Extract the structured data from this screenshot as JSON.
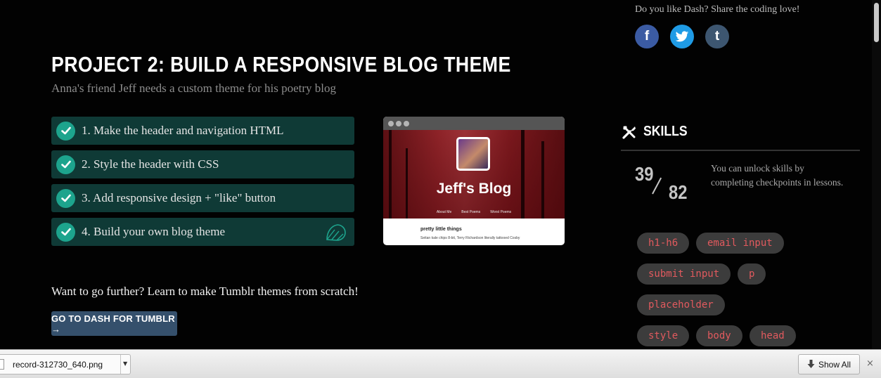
{
  "project": {
    "title": "PROJECT 2: BUILD A RESPONSIVE BLOG THEME",
    "subtitle": "Anna's friend Jeff needs a custom theme for his poetry blog"
  },
  "checklist": [
    {
      "label": "1. Make the header and navigation HTML",
      "done": true
    },
    {
      "label": "2. Style the header with CSS",
      "done": true
    },
    {
      "label": "3. Add responsive design + \"like\" button",
      "done": true
    },
    {
      "label": "4. Build your own blog theme",
      "done": true
    }
  ],
  "preview": {
    "blog_title": "Jeff's Blog",
    "nav": [
      "About Me",
      "Best Poems",
      "Worst Poems"
    ],
    "post_title": "pretty little things",
    "post_text": "Seitan kale chips 8-bit, Terry Richardson literally tattooed Cosby"
  },
  "further": {
    "text": "Want to go further? Learn to make Tumblr themes from scratch!",
    "button_label": "GO TO DASH FOR TUMBLR →"
  },
  "share": {
    "text": "Do you like Dash? Share the coding love!",
    "buttons": [
      {
        "icon": "facebook-icon",
        "glyph": "f",
        "color": "#3b5ba3"
      },
      {
        "icon": "twitter-icon",
        "glyph": "",
        "color": "#1f9be5"
      },
      {
        "icon": "tumblr-icon",
        "glyph": "t",
        "color": "#3d5670"
      }
    ]
  },
  "skills": {
    "title": "SKILLS",
    "unlocked": "39",
    "total": "82",
    "note": "You can unlock skills by completing checkpoints in lessons.",
    "tags": [
      "h1-h6",
      "email input",
      "submit input",
      "p",
      "placeholder",
      "style",
      "body",
      "head"
    ]
  },
  "download_bar": {
    "file_name": "record-312730_640.png",
    "show_all": "Show All",
    "close": "×"
  }
}
